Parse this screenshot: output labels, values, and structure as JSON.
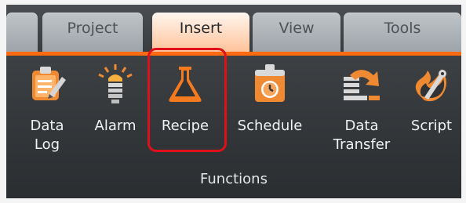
{
  "tabs": [
    {
      "label": ""
    },
    {
      "label": "Project"
    },
    {
      "label": "Insert",
      "active": true
    },
    {
      "label": "View"
    },
    {
      "label": "Tools"
    }
  ],
  "ribbon": {
    "group_label": "Functions",
    "items": [
      {
        "label": "Data\nLog",
        "icon": "data-log-icon"
      },
      {
        "label": "Alarm",
        "icon": "alarm-icon"
      },
      {
        "label": "Recipe",
        "icon": "recipe-flask-icon",
        "highlighted": true
      },
      {
        "label": "Schedule",
        "icon": "schedule-icon"
      },
      {
        "label": "Data\nTransfer",
        "icon": "data-transfer-icon"
      },
      {
        "label": "Script",
        "icon": "script-icon"
      }
    ]
  },
  "colors": {
    "accent": "#ff6a13",
    "highlight": "#e0101a",
    "ribbon_background": "#2f3336"
  }
}
